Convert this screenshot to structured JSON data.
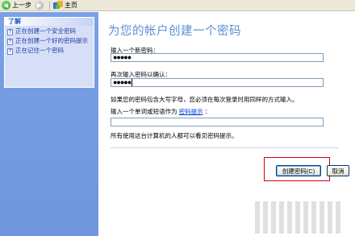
{
  "toolbar": {
    "back_label": "上一步",
    "home_label": "主页"
  },
  "sidebar": {
    "panel_title": "了解",
    "tasks": [
      {
        "label": "正在创建一个安全密码"
      },
      {
        "label": "正在创建一个好的密码提示"
      },
      {
        "label": "正在记住一个密码"
      }
    ]
  },
  "main": {
    "title": "为您的帐户创建一个密码",
    "new_password_label": "输入一个新密码：",
    "new_password_value": "●●●●●",
    "confirm_label": "再次输入密码以确认：",
    "confirm_value": "●●●●●",
    "case_note": "如果您的密码包含大写字母，您必须在每次登录时用同样的方式输入。",
    "hint_label_prefix": "输入一个单词或短语作为",
    "hint_link": "密码提示",
    "hint_label_suffix": "：",
    "hint_value": "",
    "visibility_note": "所有使用这台计算机的人都可以看见密码提示。",
    "create_button": "创建密码(C)",
    "cancel_button": "取消"
  },
  "colors": {
    "title": "#5b8fd6",
    "sidebar": "#7aa1e6",
    "panel": "#d6dff7",
    "highlight": "#d4000f"
  }
}
